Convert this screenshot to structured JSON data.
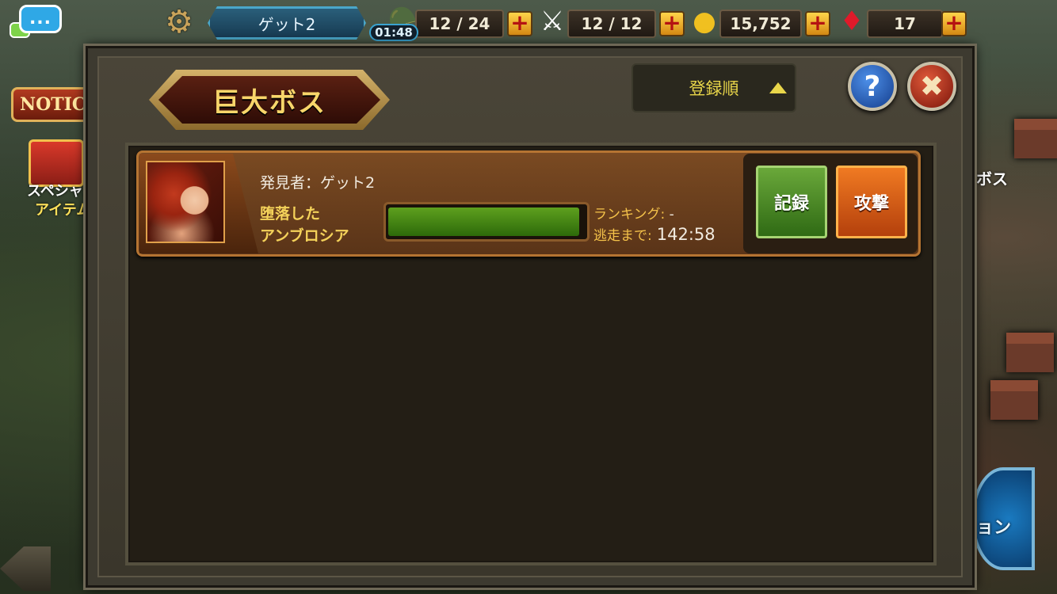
{
  "hud": {
    "player_name": "ゲット2",
    "stamina": "12 / 24",
    "stamina_timer": "01:48",
    "battle_points": "12 / 12",
    "gold": "15,752",
    "gems": "17",
    "plus_label": "+",
    "chat_label": "..."
  },
  "side": {
    "notice_label": "NOTIC",
    "special_line1": "スペシャル",
    "special_line2": "アイテム",
    "right_label": "ボス",
    "right_wheel_label": "ョン"
  },
  "panel": {
    "title": "巨大ボス",
    "sort_label": "登録順",
    "help_label": "?",
    "close_label": "✖"
  },
  "boss_list": [
    {
      "discoverer": "発見者：ゲット2",
      "name_line1": "堕落した",
      "name_line2": "アンブロシア",
      "hp_fraction": 0.97,
      "ranking_label": "ランキング:",
      "ranking_value": "-",
      "escape_label": "逃走まで:",
      "escape_time": "142:58",
      "record_label": "記録",
      "attack_label": "攻撃"
    }
  ],
  "colors": {
    "accent_gold": "#f4d25a",
    "hp_green": "#5ea01e",
    "attack_orange": "#f07a22",
    "record_green": "#6aa83a"
  },
  "icons": {
    "chat": "chat-bubble-icon",
    "settings": "gear-icon",
    "stamina": "winged-helmet-icon",
    "battle": "crossed-swords-icon",
    "gold": "gold-coin-icon",
    "gem": "red-gem-icon",
    "help": "question-icon",
    "close": "close-icon",
    "sort": "triangle-up-icon"
  }
}
